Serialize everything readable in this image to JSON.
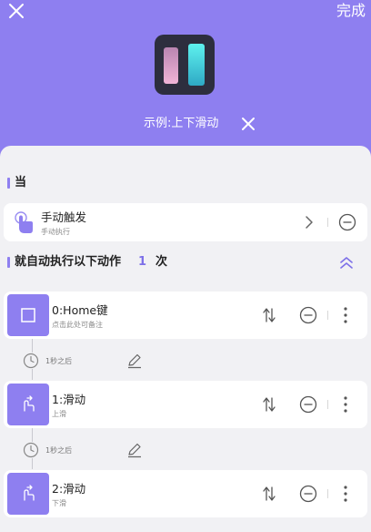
{
  "header": {
    "close_icon": "close-icon",
    "done_label": "完成",
    "title": "示例:上下滑动",
    "bg_color": "#8e7ff0"
  },
  "trigger_section": {
    "title": "当",
    "item": {
      "icon": "hand-tap-icon",
      "title": "手动触发",
      "subtitle": "手动执行"
    }
  },
  "action_section": {
    "title": "就自动执行以下动作",
    "count": "1",
    "unit": "次"
  },
  "actions": [
    {
      "icon": "square-icon",
      "title": "0:Home键",
      "subtitle": "点击此处可备注"
    },
    {
      "icon": "swipe-gesture-icon",
      "title": "1:滑动",
      "subtitle": "上滑"
    },
    {
      "icon": "swipe-gesture-icon",
      "title": "2:滑动",
      "subtitle": "下滑"
    }
  ],
  "delays": [
    {
      "text": "1秒之后"
    },
    {
      "text": "1秒之后"
    }
  ],
  "colors": {
    "accent": "#8e7ff0",
    "count": "#7d70e8",
    "background": "#f1f1f4"
  }
}
